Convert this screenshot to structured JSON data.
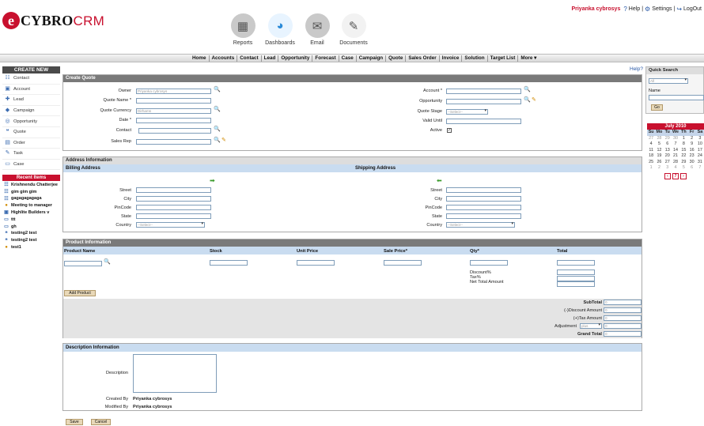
{
  "header": {
    "logo_letter": "e",
    "logo_cybro": "CYBRO",
    "logo_crm": "CRM",
    "user": "Priyanka cybrosys",
    "help": "Help",
    "settings": "Settings",
    "logout": "LogOut",
    "icons": [
      {
        "label": "Reports",
        "icon": "reports-icon",
        "glyph": "▦"
      },
      {
        "label": "Dashboards",
        "icon": "dashboards-icon",
        "glyph": "◕"
      },
      {
        "label": "Email",
        "icon": "email-icon",
        "glyph": "✉"
      },
      {
        "label": "Documents",
        "icon": "documents-icon",
        "glyph": "✎"
      }
    ]
  },
  "menu": [
    "Home",
    "Accounts",
    "Contact",
    "Lead",
    "Opportunity",
    "Forecast",
    "Case",
    "Campaign",
    "Quote",
    "Sales Order",
    "Invoice",
    "Solution",
    "Target List",
    "More ▾"
  ],
  "sidebar": {
    "create_new": "CREATE NEW",
    "items": [
      {
        "label": "Contact",
        "glyph": "☷"
      },
      {
        "label": "Account",
        "glyph": "▣"
      },
      {
        "label": "Lead",
        "glyph": "✚"
      },
      {
        "label": "Campaign",
        "glyph": "◆"
      },
      {
        "label": "Opportunity",
        "glyph": "◎"
      },
      {
        "label": "Quote",
        "glyph": "❝"
      },
      {
        "label": "Order",
        "glyph": "▤"
      },
      {
        "label": "Task",
        "glyph": "✎"
      },
      {
        "label": "Case",
        "glyph": "▭"
      }
    ],
    "recent_title": "Recent Items",
    "recent": [
      "Krishnendu Chatterjee",
      "gim gim gim",
      "gagagagagaga",
      "Meeting to manager",
      "Highlite Builders v",
      "ttt",
      "gh",
      "testing2 test",
      "testing2 test",
      "test1"
    ]
  },
  "help_link": "Help?",
  "create_quote": {
    "title": "Create Quote",
    "owner_label": "Owner",
    "owner_value": "Priyanka cybrosys",
    "quote_name_label": "Quote Name *",
    "quote_currency_label": "Quote Currency",
    "quote_currency_value": "Dirhams",
    "date_label": "Date *",
    "contact_label": "Contact",
    "sales_rep_label": "Sales Rep",
    "account_label": "Account *",
    "opportunity_label": "Opportunity",
    "quote_stage_label": "Quote Stage",
    "quote_stage_value": "--Select--",
    "valid_until_label": "Valid Until",
    "active_label": "Active",
    "active_check": "✓"
  },
  "address": {
    "title": "Address Information",
    "billing": "Billing Address",
    "shipping": "Shipping Address",
    "street": "Street",
    "city": "City",
    "pincode": "PinCode",
    "state": "State",
    "country": "Country",
    "country_value": "--Select--"
  },
  "product": {
    "title": "Product Information",
    "columns": [
      "Product Name",
      "Stock",
      "Unit Price",
      "Sale Price*",
      "Qty*",
      "Total"
    ],
    "discount": "Discount%",
    "tax": "Tax%",
    "net_total": "Net Total Amount",
    "add_product": "Add Product",
    "subtotal": "SubTotal",
    "discount_amount": "(-)Discount Amount",
    "tax_amount": "(+)Tax Amount",
    "adjustment": "Adjustment",
    "adjustment_value": "plus",
    "grand_total": "Grand Total",
    "zero": "0"
  },
  "description": {
    "title": "Description Information",
    "description_label": "Description",
    "created_by_label": "Created By",
    "created_by": "Priyanka cybrosys",
    "modified_by_label": "Modified By",
    "modified_by": "Priyanka cybrosys"
  },
  "actions": {
    "save": "Save",
    "cancel": "Cancel"
  },
  "quick_search": {
    "title": "Quick Search",
    "module": "All",
    "field_label": "Name",
    "go": "Go"
  },
  "calendar": {
    "title": "July 2010",
    "day_headers": [
      "Su",
      "Mo",
      "Tu",
      "We",
      "Th",
      "Fr",
      "Sa"
    ],
    "weeks": [
      [
        "27",
        "28",
        "29",
        "30",
        "1",
        "2",
        "3"
      ],
      [
        "4",
        "5",
        "6",
        "7",
        "8",
        "9",
        "10"
      ],
      [
        "11",
        "12",
        "13",
        "14",
        "15",
        "16",
        "17"
      ],
      [
        "18",
        "19",
        "20",
        "21",
        "22",
        "23",
        "24"
      ],
      [
        "25",
        "26",
        "27",
        "28",
        "29",
        "30",
        "31"
      ],
      [
        "1",
        "2",
        "3",
        "4",
        "5",
        "6",
        "7"
      ]
    ],
    "nav": [
      "‹",
      "7",
      "›"
    ]
  }
}
